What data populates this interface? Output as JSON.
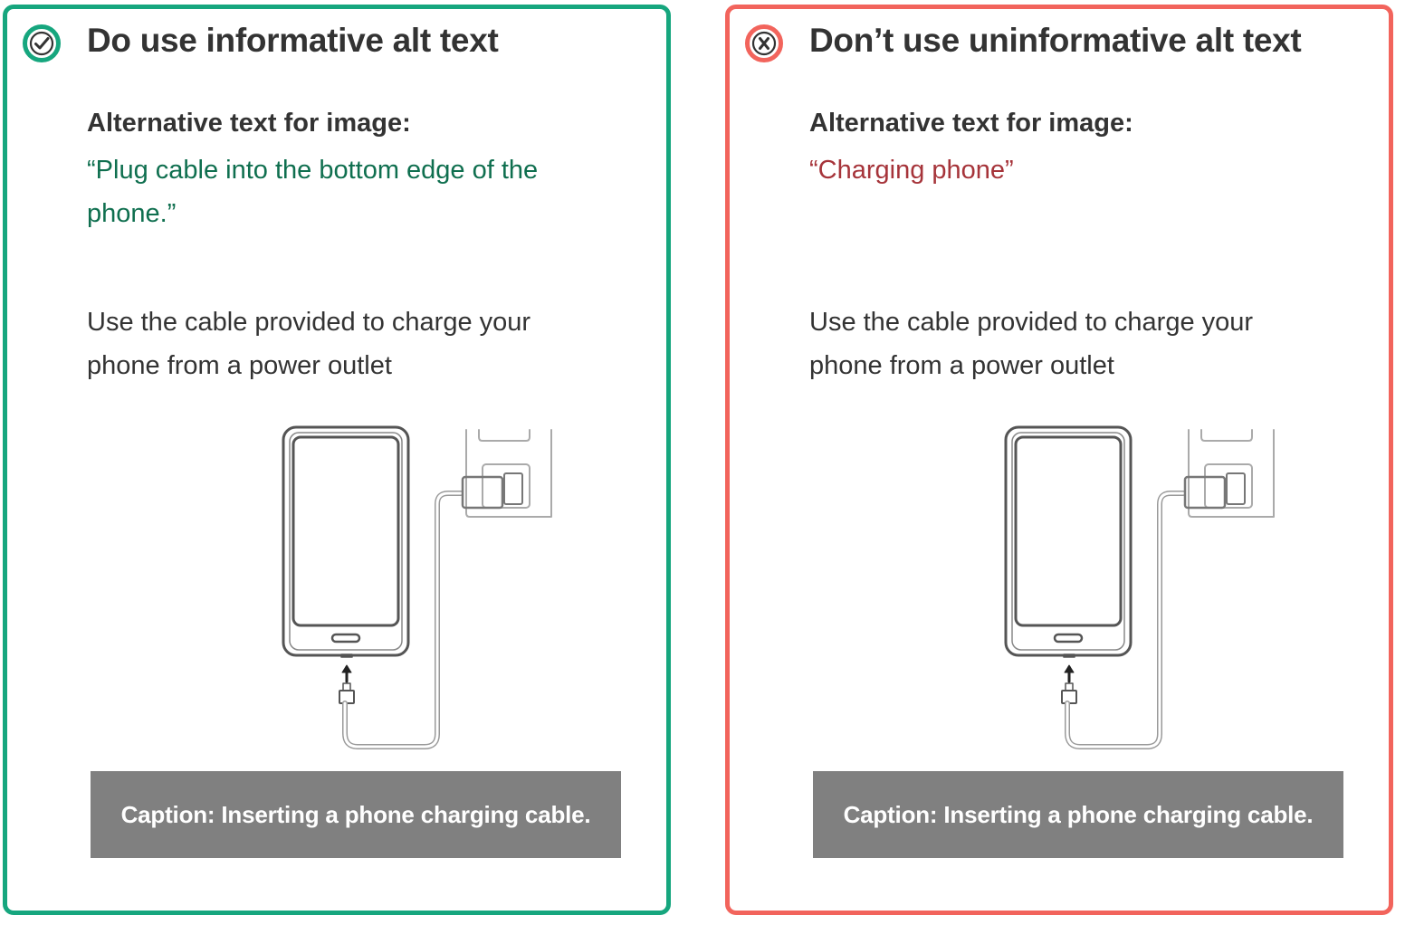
{
  "colors": {
    "do_accent": "#16a67e",
    "dont_accent": "#f2645c",
    "do_alt_text": "#0f6f4f",
    "dont_alt_text": "#a6343a",
    "caption_bg": "#808080"
  },
  "do_panel": {
    "icon": "checkmark-icon",
    "heading": "Do use informative alt text",
    "alt_label": "Alternative text for image:",
    "alt_value": "“Plug cable into the bottom edge of the phone.”",
    "body": "Use the cable provided to charge your phone from a power outlet",
    "caption": "Caption: Inserting a phone charging cable."
  },
  "dont_panel": {
    "icon": "x-icon",
    "heading": "Don’t use uninformative alt text",
    "alt_label": "Alternative text for image:",
    "alt_value": "“Charging phone”",
    "body": "Use the cable provided to charge your phone from a power outlet",
    "caption": "Caption: Inserting a phone charging cable."
  }
}
